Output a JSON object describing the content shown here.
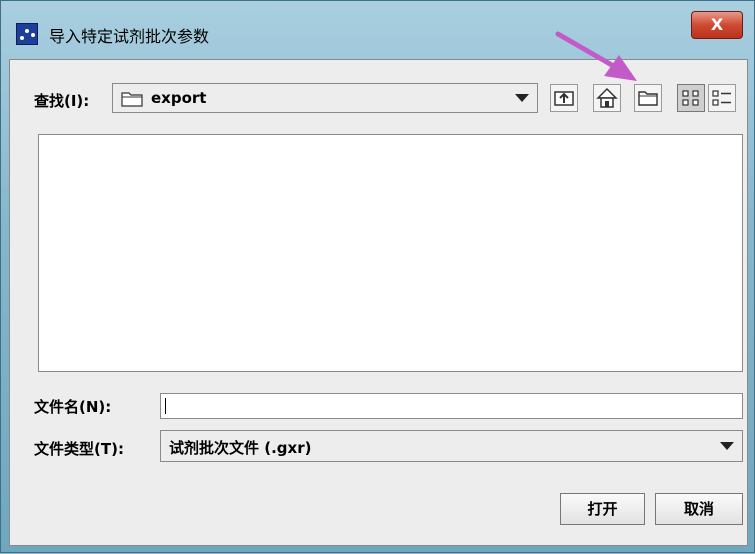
{
  "window": {
    "title": "导入特定试剂批次参数",
    "close_label": "X"
  },
  "lookin": {
    "label": "查找(I):",
    "value": "export"
  },
  "toolbar": {
    "icons": [
      "up-one-level-icon",
      "home-icon",
      "new-folder-icon",
      "list-view-icon",
      "details-view-icon"
    ],
    "selected": "list-view-icon"
  },
  "filename": {
    "label": "文件名(N):",
    "value": ""
  },
  "filetype": {
    "label": "文件类型(T):",
    "value": "试剂批次文件 (.gxr)"
  },
  "buttons": {
    "open": "打开",
    "cancel": "取消"
  },
  "annotation": {
    "color": "#c25ac8",
    "target": "new-folder-icon"
  }
}
